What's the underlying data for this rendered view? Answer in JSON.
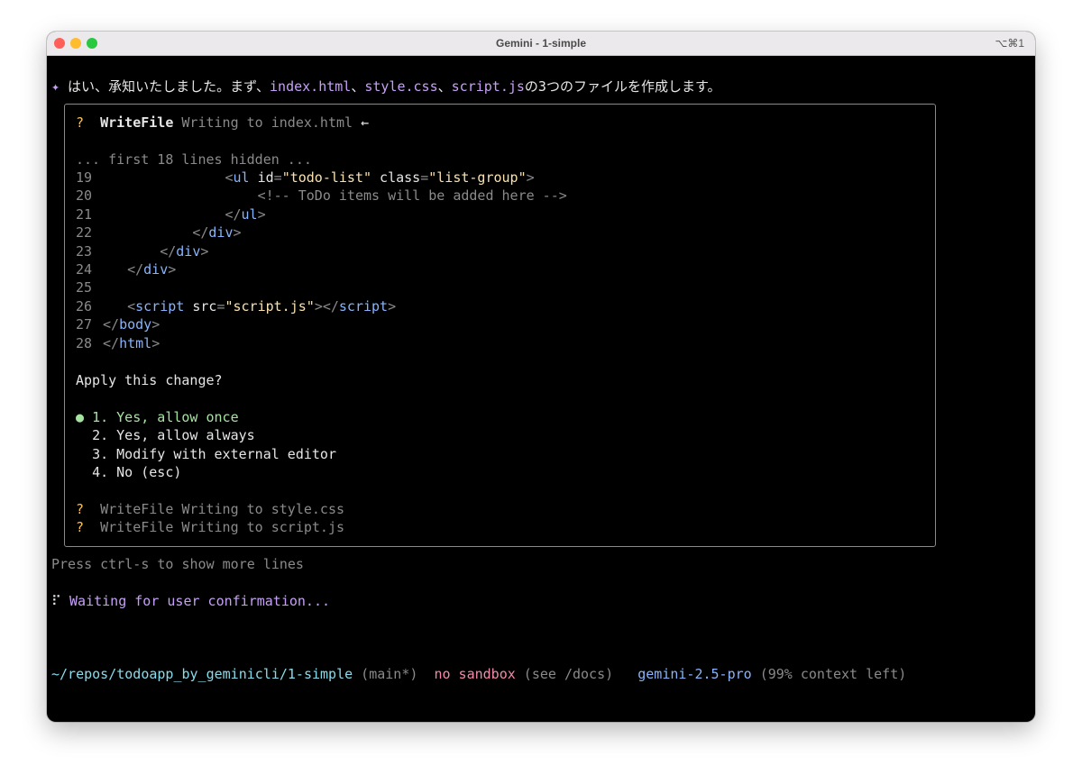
{
  "window": {
    "title": "Gemini - 1-simple",
    "shortcut": "⌥⌘1"
  },
  "message": {
    "spark": "✦",
    "prefix": " はい、承知いたしました。まず、",
    "file1": "index.html",
    "sep1": "、",
    "file2": "style.css",
    "sep2": "、",
    "file3": "script.js",
    "suffix": "の3つのファイルを作成します。"
  },
  "tool": {
    "mark": "?",
    "name": "WriteFile",
    "desc": "Writing to index.html",
    "arrow": "←",
    "hidden_note": "... first 18 lines hidden ...",
    "code_lines": [
      {
        "num": "19",
        "indent": "               ",
        "content": [
          {
            "t": "<",
            "c": "gray"
          },
          {
            "t": "ul",
            "c": "blue"
          },
          {
            "t": " id",
            "c": "white"
          },
          {
            "t": "=",
            "c": "gray"
          },
          {
            "t": "\"todo-list\"",
            "c": "string"
          },
          {
            "t": " class",
            "c": "white"
          },
          {
            "t": "=",
            "c": "gray"
          },
          {
            "t": "\"list-group\"",
            "c": "string"
          },
          {
            "t": ">",
            "c": "gray"
          }
        ]
      },
      {
        "num": "20",
        "indent": "                   ",
        "content": [
          {
            "t": "<!-- ToDo items will be added here -->",
            "c": "gray"
          }
        ]
      },
      {
        "num": "21",
        "indent": "               ",
        "content": [
          {
            "t": "</",
            "c": "gray"
          },
          {
            "t": "ul",
            "c": "blue"
          },
          {
            "t": ">",
            "c": "gray"
          }
        ]
      },
      {
        "num": "22",
        "indent": "           ",
        "content": [
          {
            "t": "</",
            "c": "gray"
          },
          {
            "t": "div",
            "c": "blue"
          },
          {
            "t": ">",
            "c": "gray"
          }
        ]
      },
      {
        "num": "23",
        "indent": "       ",
        "content": [
          {
            "t": "</",
            "c": "gray"
          },
          {
            "t": "div",
            "c": "blue"
          },
          {
            "t": ">",
            "c": "gray"
          }
        ]
      },
      {
        "num": "24",
        "indent": "   ",
        "content": [
          {
            "t": "</",
            "c": "gray"
          },
          {
            "t": "div",
            "c": "blue"
          },
          {
            "t": ">",
            "c": "gray"
          }
        ]
      },
      {
        "num": "25",
        "indent": "",
        "content": []
      },
      {
        "num": "26",
        "indent": "   ",
        "content": [
          {
            "t": "<",
            "c": "gray"
          },
          {
            "t": "script",
            "c": "blue"
          },
          {
            "t": " src",
            "c": "white"
          },
          {
            "t": "=",
            "c": "gray"
          },
          {
            "t": "\"script.js\"",
            "c": "string"
          },
          {
            "t": "></",
            "c": "gray"
          },
          {
            "t": "script",
            "c": "blue"
          },
          {
            "t": ">",
            "c": "gray"
          }
        ]
      },
      {
        "num": "27",
        "indent": "",
        "content": [
          {
            "t": "</",
            "c": "gray"
          },
          {
            "t": "body",
            "c": "blue"
          },
          {
            "t": ">",
            "c": "gray"
          }
        ]
      },
      {
        "num": "28",
        "indent": "",
        "content": [
          {
            "t": "</",
            "c": "gray"
          },
          {
            "t": "html",
            "c": "blue"
          },
          {
            "t": ">",
            "c": "gray"
          }
        ]
      }
    ],
    "question": "Apply this change?",
    "selected_marker": "●",
    "options": [
      {
        "label": "1. Yes, allow once",
        "selected": true
      },
      {
        "label": "2. Yes, allow always",
        "selected": false
      },
      {
        "label": "3. Modify with external editor",
        "selected": false
      },
      {
        "label": "4. No (esc)",
        "selected": false
      }
    ],
    "pending": [
      {
        "mark": "?",
        "name": "WriteFile",
        "desc": "Writing to style.css"
      },
      {
        "mark": "?",
        "name": "WriteFile",
        "desc": "Writing to script.js"
      }
    ]
  },
  "hint": "Press ctrl-s to show more lines",
  "status": {
    "spinner": "⠏",
    "text": "Waiting for user confirmation..."
  },
  "footer": {
    "path": "~/repos/todoapp_by_geminicli/1-simple",
    "branch": "(main*)",
    "sandbox": "no sandbox",
    "sandbox_note": "(see /docs)",
    "model": "gemini-2.5-pro",
    "context": "(99% context left)"
  },
  "colors": {
    "purple": "#c6a0f6",
    "yellow": "#f5c25c",
    "gray": "#8a8a8a",
    "white": "#e6e6e6",
    "green": "#a6e3a1",
    "blue": "#89b4fa",
    "string": "#f9e2af",
    "pink": "#f38ba8",
    "cyan": "#89dceb"
  }
}
